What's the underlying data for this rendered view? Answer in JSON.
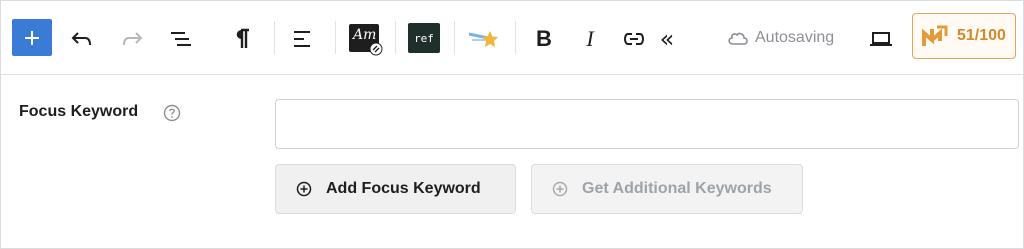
{
  "toolbar": {
    "autosave_label": "Autosaving",
    "am_label": "Am",
    "ref_label": "ref",
    "bold_label": "B",
    "italic_label": "I",
    "collapse_label": "«",
    "score": "51/100",
    "colors": {
      "add_button": "#3a7bd5",
      "score": "#d18a2e"
    }
  },
  "focus": {
    "label": "Focus Keyword",
    "input_value": "",
    "add_button_label": "Add Focus Keyword",
    "additional_button_label": "Get Additional Keywords"
  }
}
